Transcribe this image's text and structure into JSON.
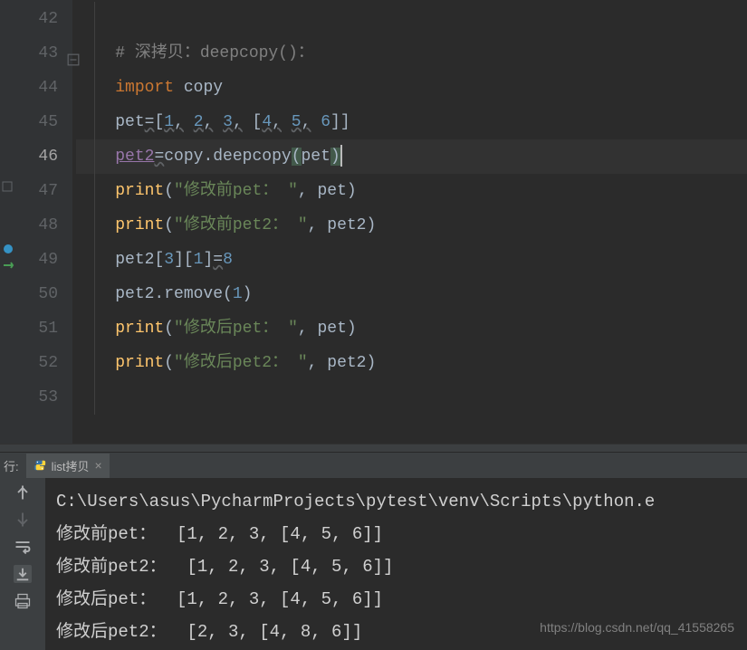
{
  "editor": {
    "lines": [
      {
        "num": "42",
        "tokens": []
      },
      {
        "num": "43",
        "tokens": [
          {
            "cls": "cmt",
            "t": "# 深拷贝：deepcopy()："
          }
        ]
      },
      {
        "num": "44",
        "tokens": [
          {
            "cls": "kw",
            "t": "import"
          },
          {
            "cls": "op",
            "t": " "
          },
          {
            "cls": "var",
            "t": "copy"
          }
        ]
      },
      {
        "num": "45",
        "tokens": [
          {
            "cls": "var",
            "t": "pet"
          },
          {
            "cls": "op wavy",
            "t": "="
          },
          {
            "cls": "op",
            "t": "["
          },
          {
            "cls": "num wavy",
            "t": "1"
          },
          {
            "cls": "op wavy",
            "t": ","
          },
          {
            "cls": "op",
            "t": " "
          },
          {
            "cls": "num wavy",
            "t": "2"
          },
          {
            "cls": "op wavy",
            "t": ","
          },
          {
            "cls": "op",
            "t": " "
          },
          {
            "cls": "num wavy",
            "t": "3"
          },
          {
            "cls": "op wavy",
            "t": ","
          },
          {
            "cls": "op",
            "t": " ["
          },
          {
            "cls": "num wavy",
            "t": "4"
          },
          {
            "cls": "op wavy",
            "t": ","
          },
          {
            "cls": "op",
            "t": " "
          },
          {
            "cls": "num wavy",
            "t": "5"
          },
          {
            "cls": "op wavy",
            "t": ","
          },
          {
            "cls": "op",
            "t": " "
          },
          {
            "cls": "num",
            "t": "6"
          },
          {
            "cls": "op",
            "t": "]]"
          }
        ]
      },
      {
        "num": "46",
        "current": true,
        "tokens": [
          {
            "cls": "uline",
            "t": "pet2"
          },
          {
            "cls": "op wavy",
            "t": "="
          },
          {
            "cls": "var",
            "t": "copy.deepcopy"
          },
          {
            "cls": "op hilite",
            "t": "("
          },
          {
            "cls": "var",
            "t": "pet"
          },
          {
            "cls": "op hilite",
            "t": ")"
          }
        ]
      },
      {
        "num": "47",
        "tokens": [
          {
            "cls": "fn",
            "t": "print"
          },
          {
            "cls": "op",
            "t": "("
          },
          {
            "cls": "str",
            "t": "\"修改前pet："
          },
          {
            "cls": "str",
            "t": " \""
          },
          {
            "cls": "op",
            "t": ", "
          },
          {
            "cls": "var",
            "t": "pet"
          },
          {
            "cls": "op",
            "t": ")"
          }
        ]
      },
      {
        "num": "48",
        "tokens": [
          {
            "cls": "fn",
            "t": "print"
          },
          {
            "cls": "op",
            "t": "("
          },
          {
            "cls": "str",
            "t": "\"修改前pet2："
          },
          {
            "cls": "str",
            "t": " \""
          },
          {
            "cls": "op",
            "t": ", "
          },
          {
            "cls": "var",
            "t": "pet2"
          },
          {
            "cls": "op",
            "t": ")"
          }
        ]
      },
      {
        "num": "49",
        "tokens": [
          {
            "cls": "var",
            "t": "pet2"
          },
          {
            "cls": "op",
            "t": "["
          },
          {
            "cls": "num",
            "t": "3"
          },
          {
            "cls": "op",
            "t": "]["
          },
          {
            "cls": "num",
            "t": "1"
          },
          {
            "cls": "op",
            "t": "]"
          },
          {
            "cls": "op wavy",
            "t": "="
          },
          {
            "cls": "num",
            "t": "8"
          }
        ]
      },
      {
        "num": "50",
        "tokens": [
          {
            "cls": "var",
            "t": "pet2.remove("
          },
          {
            "cls": "num",
            "t": "1"
          },
          {
            "cls": "op",
            "t": ")"
          }
        ]
      },
      {
        "num": "51",
        "tokens": [
          {
            "cls": "fn",
            "t": "print"
          },
          {
            "cls": "op",
            "t": "("
          },
          {
            "cls": "str",
            "t": "\"修改后pet："
          },
          {
            "cls": "str",
            "t": " \""
          },
          {
            "cls": "op",
            "t": ", "
          },
          {
            "cls": "var",
            "t": "pet"
          },
          {
            "cls": "op",
            "t": ")"
          }
        ]
      },
      {
        "num": "52",
        "tokens": [
          {
            "cls": "fn",
            "t": "print"
          },
          {
            "cls": "op",
            "t": "("
          },
          {
            "cls": "str",
            "t": "\"修改后pet2："
          },
          {
            "cls": "str",
            "t": " \""
          },
          {
            "cls": "op",
            "t": ", "
          },
          {
            "cls": "var",
            "t": "pet2"
          },
          {
            "cls": "op",
            "t": ")"
          }
        ]
      },
      {
        "num": "53",
        "tokens": []
      }
    ]
  },
  "tabbar": {
    "run_label": "行:",
    "tab_name": "list拷贝",
    "close_symbol": "×"
  },
  "console": {
    "lines": [
      "C:\\Users\\asus\\PycharmProjects\\pytest\\venv\\Scripts\\python.e",
      "修改前pet：  [1, 2, 3, [4, 5, 6]]",
      "修改前pet2：  [1, 2, 3, [4, 5, 6]]",
      "修改后pet：  [1, 2, 3, [4, 5, 6]]",
      "修改后pet2：  [2, 3, [4, 8, 6]]"
    ]
  },
  "watermark": "https://blog.csdn.net/qq_41558265"
}
